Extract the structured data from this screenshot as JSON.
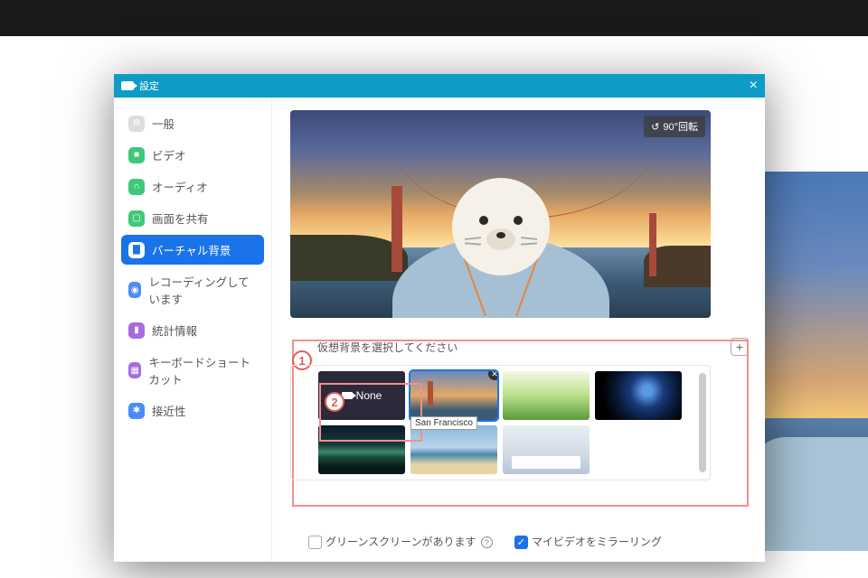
{
  "window": {
    "title": "設定"
  },
  "sidebar": {
    "items": [
      {
        "label": "一般"
      },
      {
        "label": "ビデオ"
      },
      {
        "label": "オーディオ"
      },
      {
        "label": "画面を共有"
      },
      {
        "label": "バーチャル背景"
      },
      {
        "label": "レコーディングしています"
      },
      {
        "label": "統計情報"
      },
      {
        "label": "キーボードショートカット"
      },
      {
        "label": "接近性"
      }
    ]
  },
  "preview": {
    "rotate_label": "90°回転"
  },
  "vbg": {
    "choose_label": "仮想背景を選択してください",
    "none_label": "None",
    "tooltip": "San Francisco"
  },
  "options": {
    "green_screen": "グリーンスクリーンがあります",
    "mirror": "マイビデオをミラーリング"
  },
  "markers": {
    "one": "1",
    "two": "2"
  }
}
